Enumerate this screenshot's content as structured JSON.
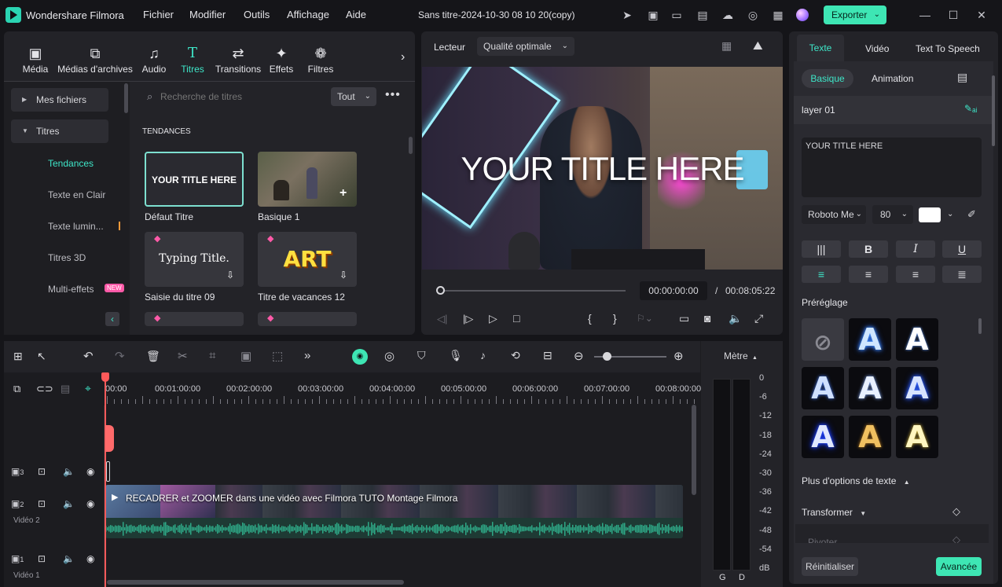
{
  "app": {
    "name": "Wondershare Filmora",
    "project_title": "Sans titre-2024-10-30 08 10 20(copy)",
    "export_label": "Exporter"
  },
  "menu": [
    "Fichier",
    "Modifier",
    "Outils",
    "Affichage",
    "Aide"
  ],
  "media_tabs": [
    {
      "label": "Média",
      "icon": "media-icon"
    },
    {
      "label": "Médias d'archives",
      "icon": "stock-media-icon"
    },
    {
      "label": "Audio",
      "icon": "music-note-icon"
    },
    {
      "label": "Titres",
      "icon": "title-t-icon"
    },
    {
      "label": "Transitions",
      "icon": "transition-icon"
    },
    {
      "label": "Effets",
      "icon": "effects-icon"
    },
    {
      "label": "Filtres",
      "icon": "filters-icon"
    }
  ],
  "sidebar": {
    "my_files": "Mes fichiers",
    "titles": "Titres",
    "subitems": [
      "Tendances",
      "Texte en Clair",
      "Texte lumin...",
      "Titres 3D",
      "Multi-effets"
    ],
    "new_badge": "NEW"
  },
  "search": {
    "placeholder": "Recherche de titres",
    "filter": "Tout"
  },
  "section_title": "TENDANCES",
  "cards": [
    {
      "label": "Défaut Titre",
      "thumb_text": "YOUR TITLE HERE"
    },
    {
      "label": "Basique 1"
    },
    {
      "label": "Saisie du titre 09",
      "thumb_text": "Typing Title."
    },
    {
      "label": "Titre de vacances 12",
      "thumb_text": "ART"
    }
  ],
  "player": {
    "label": "Lecteur",
    "quality": "Qualité optimale",
    "overlay_title": "YOUR TITLE HERE",
    "current_time": "00:00:00:00",
    "separator": "/",
    "total_time": "00:08:05:22"
  },
  "props": {
    "tabs": [
      "Texte",
      "Vidéo",
      "Text To Speech"
    ],
    "subtabs": [
      "Basique",
      "Animation"
    ],
    "layer": "layer 01",
    "text_value": "YOUR TITLE HERE",
    "font": "Roboto Me",
    "size": "80",
    "text_color": "#ffffff",
    "presets_label": "Préréglage",
    "more_options": "Plus d'options de texte",
    "transform": "Transformer",
    "rotate": "Pivoter",
    "reset": "Réinitialiser",
    "advanced": "Avancée"
  },
  "timeline": {
    "meter_label": "Mètre",
    "ruler": [
      "00:00",
      "00:01:00:00",
      "00:02:00:00",
      "00:03:00:00",
      "00:04:00:00",
      "00:05:00:00",
      "00:06:00:00",
      "00:07:00:00",
      "00:08:00:00"
    ],
    "db_scale": [
      "0",
      "-6",
      "-12",
      "-18",
      "-24",
      "-30",
      "-36",
      "-42",
      "-48",
      "-54",
      "dB"
    ],
    "meter_channels": [
      "G",
      "D"
    ],
    "tracks": [
      {
        "num": "3",
        "name": ""
      },
      {
        "num": "2",
        "name": "Vidéo 2"
      },
      {
        "num": "1",
        "name": "Vidéo 1"
      }
    ],
    "clip_title": "RECADRER et ZOOMER dans une vidéo avec Filmora  TUTO Montage Filmora"
  },
  "colors": {
    "accent": "#3ee6c8",
    "export": "#3ee6b4",
    "waveform": "#2ea886",
    "playhead": "#ff5a5a"
  }
}
